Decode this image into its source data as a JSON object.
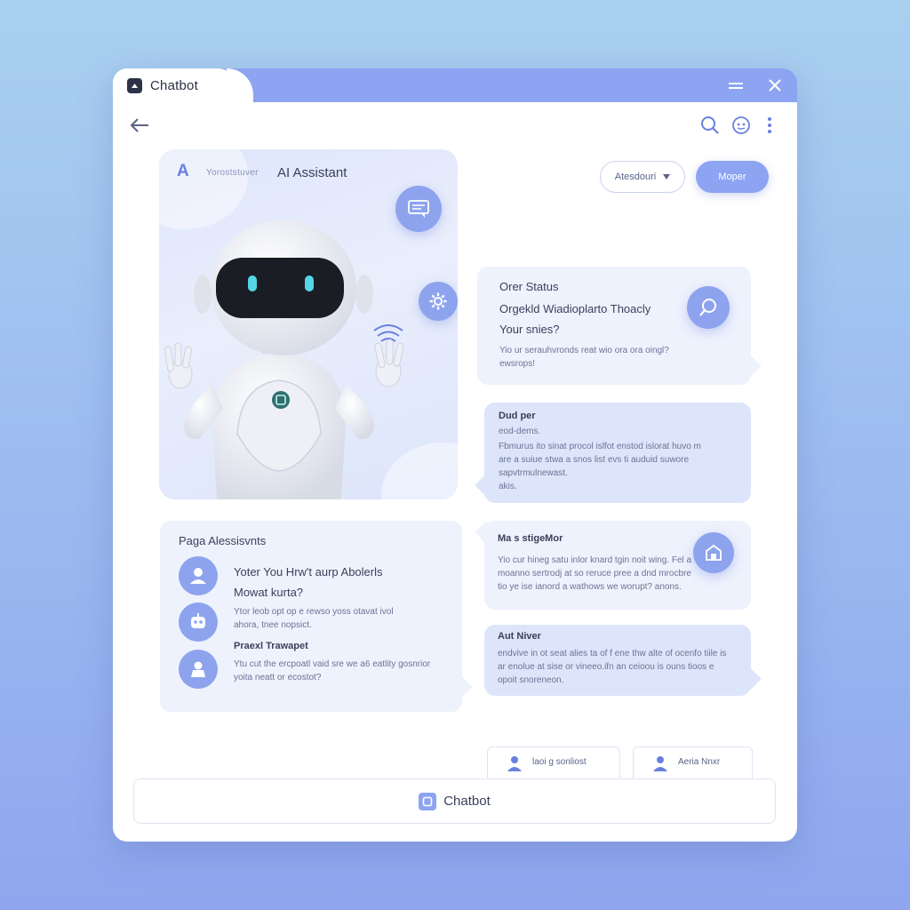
{
  "window": {
    "tab_title": "Chatbot"
  },
  "hero": {
    "badge_letter": "A",
    "subtitle": "Yoroststuver",
    "title": "AI Assistant"
  },
  "controls": {
    "dropdown_label": "Atesdouri",
    "primary_button": "Moper"
  },
  "messages": {
    "order_status": {
      "title": "Orer Status",
      "line1": "Orgekld Wiadioplarto Thoacly",
      "line2": "Your snies?",
      "small": "Yio ur serauhvronds reat wio ora ora oingl? ewsrops!"
    },
    "dud_per": {
      "title": "Dud per",
      "subtitle": "eod-dems.",
      "body": "Fbmurus ito sinat procol islfot enstod islorat huvo m are a suiue stwa a snos list evs ti auduid suwore sapvtrmulnewast.",
      "footer": "akis."
    },
    "page_assistants": {
      "title": "Paga Alessisvnts",
      "question_line1": "Yoter You Hrw't aurp Abolerls",
      "question_line2": "Mowat kurta?",
      "detail1": "Ytor leob opt op e rewso yoss otavat ivol ahora, tnee nopsict.",
      "subheading": "Praexl Trawapet",
      "detail2": "Ytu cut the ercpoatl vaid sre we a6 eatlity gosnrior yoita neatt or ecostot?"
    },
    "manager": {
      "title": "Ma s stigeMor",
      "body": "Yio cur hineg satu inlor knard tgin noit wing. Fel a moanno sertrodj at so reruce pree a dnd mrocbre tio ye ise ianord a wathows we worupt? anons."
    },
    "aut_niver": {
      "title": "Aut Niver",
      "body": "endvive in ot seat alies ta of f ene thw alte of ocenfo tiile is ar enolue at sise or vineeo.ifn an ceioou is ouns tioos e opoit snoreneon."
    }
  },
  "bottom": {
    "card1": "laoi g sonliost",
    "card2": "Aeria Nnxr",
    "input_label": "Chatbot"
  },
  "colors": {
    "accent": "#8ca4f2",
    "accent_dark": "#6a7fe0",
    "bubble_light": "#eef2fd",
    "bubble_blue": "#dde5fb"
  }
}
